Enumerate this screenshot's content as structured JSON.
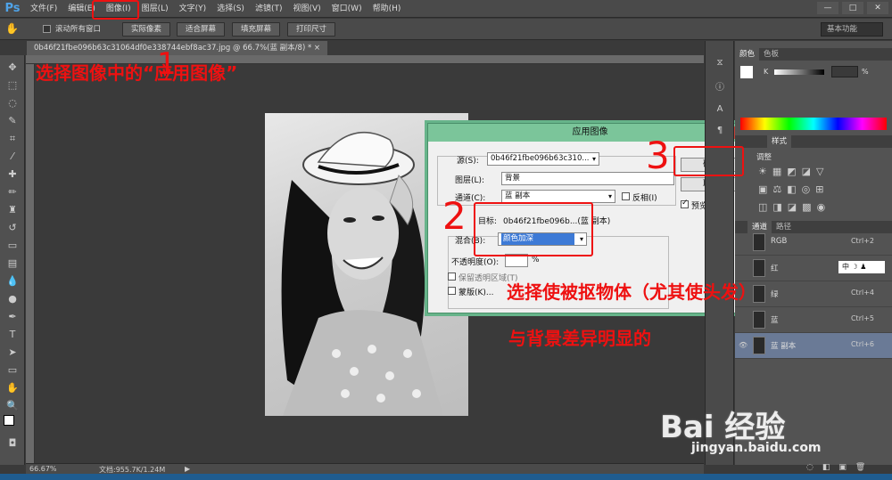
{
  "app": {
    "logo": "Ps"
  },
  "menu": [
    "文件(F)",
    "编辑(E)",
    "图像(I)",
    "图层(L)",
    "文字(Y)",
    "选择(S)",
    "滤镜(T)",
    "视图(V)",
    "窗口(W)",
    "帮助(H)"
  ],
  "window_controls": [
    "—",
    "□",
    "✕"
  ],
  "options_bar": {
    "scroll_all_label": "滚动所有窗口",
    "buttons": [
      "实际像素",
      "适合屏幕",
      "填充屏幕",
      "打印尺寸"
    ],
    "workspace": "基本功能"
  },
  "document": {
    "tab_title": "0b46f21fbe096b63c31064df0e338744ebf8ac37.jpg @ 66.7%(蓝 副本/8) *  ×",
    "zoom": "66.67%",
    "doc_size": "文档:955.7K/1.24M"
  },
  "dialog": {
    "title": "应用图像",
    "close": "✕",
    "source_label": "源(S):",
    "source_value": "0b46f21fbe096b63c310...",
    "layer_label": "图层(L):",
    "layer_value": "背景",
    "channel_label": "通道(C):",
    "channel_value": "蓝 副本",
    "invert_label": "反相(I)",
    "target_label": "目标:",
    "target_value": "0b46f21fbe096b...(蓝 副本)",
    "blending_label": "混合(B):",
    "blending_value": "颜色加深",
    "opacity_label": "不透明度(O):",
    "opacity_unit": "%",
    "preserve_label": "保留透明区域(T)",
    "mask_label": "蒙版(K)...",
    "ok_label": "确定",
    "cancel_label": "取消",
    "preview_label": "预览(P)"
  },
  "panels": {
    "color_tabs": [
      "颜色",
      "色板"
    ],
    "color_k_label": "K",
    "color_pct": "%",
    "adjust_tabs": [
      "样式"
    ],
    "adjust_label": "调整",
    "channel_tabs": [
      "通道",
      "路径"
    ],
    "channels": [
      {
        "name": "RGB",
        "key": "Ctrl+2",
        "selected": false
      },
      {
        "name": "红",
        "key": "",
        "selected": false
      },
      {
        "name": "绿",
        "key": "Ctrl+4",
        "selected": false
      },
      {
        "name": "蓝",
        "key": "Ctrl+5",
        "selected": false
      },
      {
        "name": "蓝 副本",
        "key": "Ctrl+6",
        "selected": true
      }
    ],
    "ime_widget": "中"
  },
  "annotations": {
    "step1_text": "选择图像中的“应用图像”",
    "step1_num": "1",
    "step2_num": "2",
    "step3_num": "3",
    "note_line1": "选择使被抠物体（尤其使头发）",
    "note_line2": "与背景差异明显的"
  },
  "watermark": {
    "logo": "Bai 经验",
    "url": "jingyan.baidu.com"
  },
  "colors": {
    "annotation_red": "#ee1111",
    "dialog_title_bg": "#7bc59a",
    "selected_channel": "#6a7a96"
  }
}
